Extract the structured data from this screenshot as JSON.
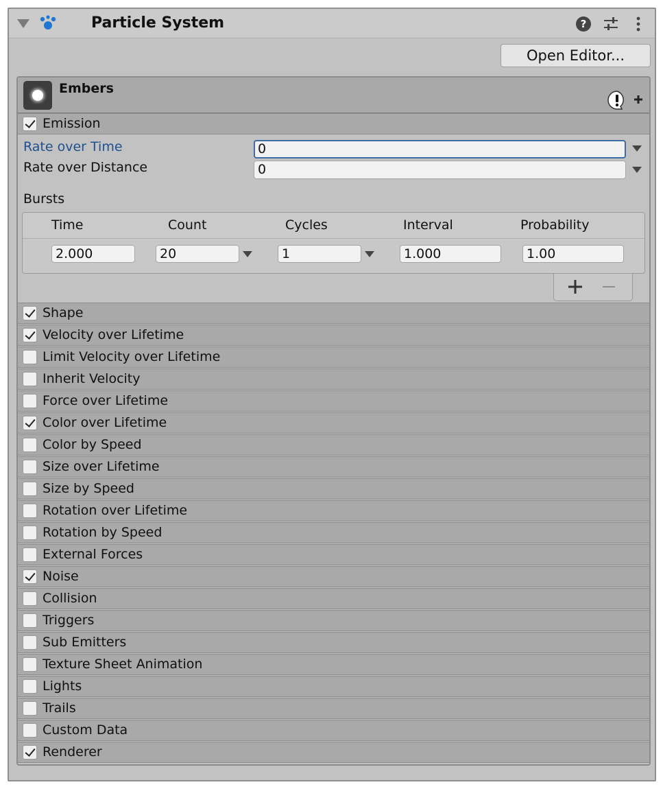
{
  "header": {
    "title": "Particle System",
    "icons": [
      "foldout-arrow-icon",
      "particle-system-icon",
      "help-icon",
      "presets-icon",
      "more-options-icon"
    ],
    "open_editor_label": "Open Editor..."
  },
  "system": {
    "name": "Embers"
  },
  "emission": {
    "label": "Emission",
    "enabled": true,
    "rate_over_time_label": "Rate over Time",
    "rate_over_time_value": "0",
    "rate_over_distance_label": "Rate over Distance",
    "rate_over_distance_value": "0",
    "bursts_label": "Bursts",
    "bursts_columns": [
      "Time",
      "Count",
      "Cycles",
      "Interval",
      "Probability"
    ],
    "bursts_row": {
      "time": "2.000",
      "count": "20",
      "cycles": "1",
      "interval": "1.000",
      "probability": "1.00"
    }
  },
  "modules": [
    {
      "label": "Shape",
      "enabled": true
    },
    {
      "label": "Velocity over Lifetime",
      "enabled": true
    },
    {
      "label": "Limit Velocity over Lifetime",
      "enabled": false
    },
    {
      "label": "Inherit Velocity",
      "enabled": false
    },
    {
      "label": "Force over Lifetime",
      "enabled": false
    },
    {
      "label": "Color over Lifetime",
      "enabled": true
    },
    {
      "label": "Color by Speed",
      "enabled": false
    },
    {
      "label": "Size over Lifetime",
      "enabled": false
    },
    {
      "label": "Size by Speed",
      "enabled": false
    },
    {
      "label": "Rotation over Lifetime",
      "enabled": false
    },
    {
      "label": "Rotation by Speed",
      "enabled": false
    },
    {
      "label": "External Forces",
      "enabled": false
    },
    {
      "label": "Noise",
      "enabled": true
    },
    {
      "label": "Collision",
      "enabled": false
    },
    {
      "label": "Triggers",
      "enabled": false
    },
    {
      "label": "Sub Emitters",
      "enabled": false
    },
    {
      "label": "Texture Sheet Animation",
      "enabled": false
    },
    {
      "label": "Lights",
      "enabled": false
    },
    {
      "label": "Trails",
      "enabled": false
    },
    {
      "label": "Custom Data",
      "enabled": false
    },
    {
      "label": "Renderer",
      "enabled": true
    }
  ],
  "colors": {
    "accent_focus": "#3d6da3",
    "focused_label": "#1f4f8f",
    "icon_blue": "#1e78d2"
  }
}
